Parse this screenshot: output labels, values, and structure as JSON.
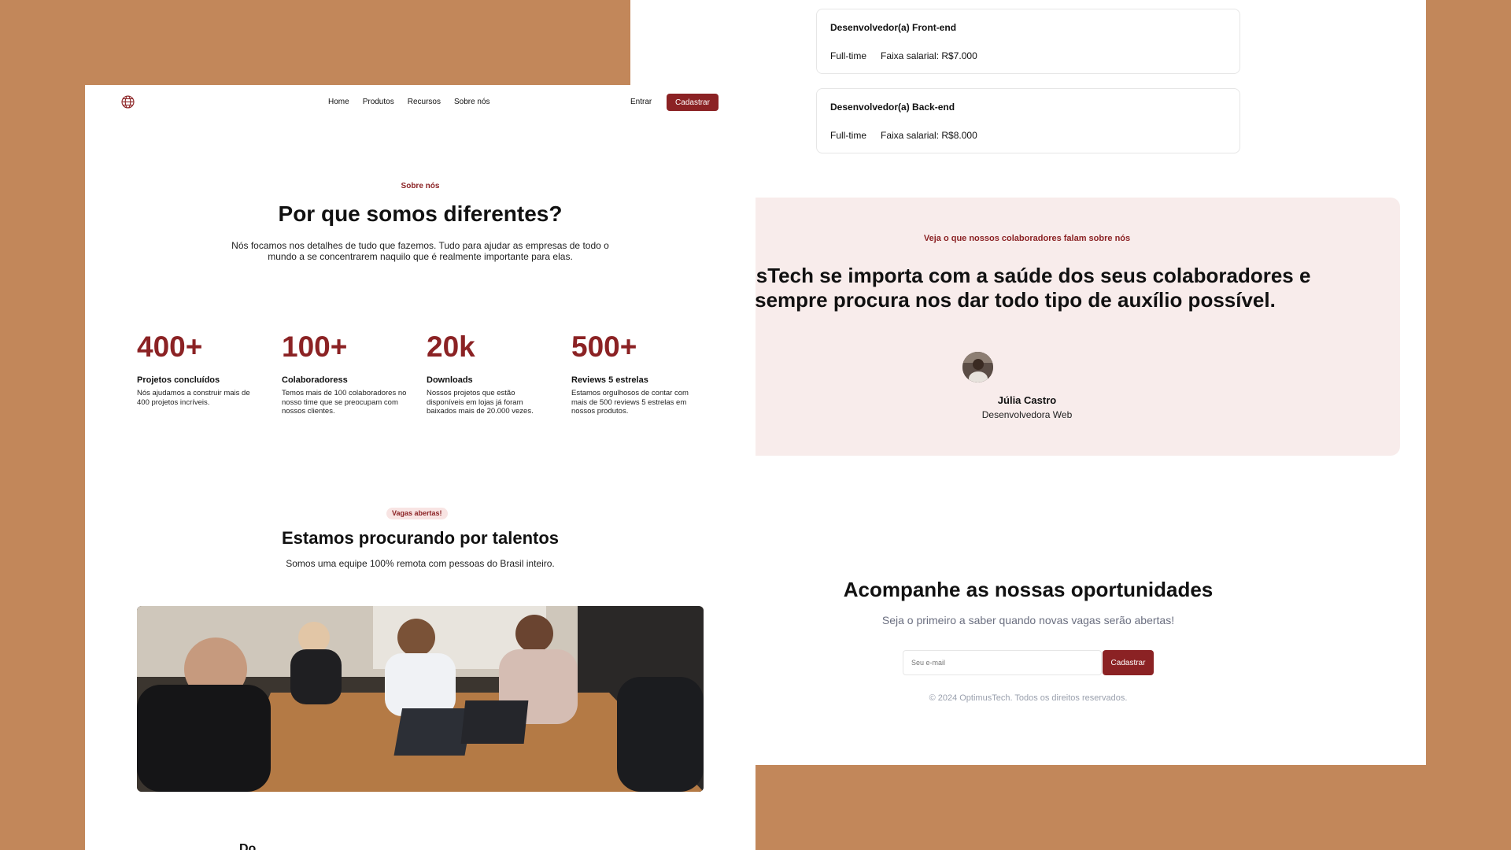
{
  "right": {
    "jobs": [
      {
        "title": "Desenvolvedor(a) Front-end",
        "type": "Full-time",
        "salary": "Faixa salarial: R$7.000"
      },
      {
        "title": "Desenvolvedor(a) Back-end",
        "type": "Full-time",
        "salary": "Faixa salarial: R$8.000"
      }
    ],
    "testimonial": {
      "kicker": "Veja o que nossos colaboradores falam sobre nós",
      "quote_line1": "imusTech se importa com a saúde dos seus colaboradores e",
      "quote_line2": "sempre procura nos dar todo tipo de auxílio possível.",
      "name": "Júlia Castro",
      "role": "Desenvolvedora Web"
    },
    "newsletter": {
      "title": "Acompanhe as nossas oportunidades",
      "subtitle": "Seja o primeiro a saber quando novas vagas serão abertas!",
      "email_placeholder": "Seu e-mail",
      "button": "Cadastrar"
    },
    "copyright": "© 2024 OptimusTech. Todos os direitos reservados."
  },
  "left": {
    "nav": [
      "Home",
      "Produtos",
      "Recursos",
      "Sobre nós"
    ],
    "login": "Entrar",
    "signup": "Cadastrar",
    "about": {
      "kicker": "Sobre nós",
      "title": "Por que somos diferentes?",
      "lead": "Nós focamos nos detalhes de tudo que fazemos. Tudo para ajudar as empresas de todo o mundo a se concentrarem naquilo que é realmente importante para elas."
    },
    "stats": [
      {
        "num": "400+",
        "label": "Projetos concluídos",
        "desc": "Nós ajudamos a construir mais de 400 projetos incríveis."
      },
      {
        "num": "100+",
        "label": "Colaboradoress",
        "desc": "Temos mais de 100 colaboradores no nosso time que se preocupam com nossos clientes."
      },
      {
        "num": "20k",
        "label": "Downloads",
        "desc": "Nossos projetos que estão disponíveis em lojas já foram baixados mais de 20.000 vezes."
      },
      {
        "num": "500+",
        "label": "Reviews 5 estrelas",
        "desc": "Estamos orgulhosos de contar com mais de 500 reviews 5 estrelas em nossos produtos."
      }
    ],
    "talent": {
      "badge": "Vagas abertas!",
      "title": "Estamos procurando por talentos",
      "subtitle": "Somos uma equipe 100% remota com pessoas do Brasil inteiro."
    },
    "cut_heading": "Do..."
  },
  "colors": {
    "accent": "#8b2224",
    "background": "#c2875a",
    "testimonial_bg": "#f8eceb"
  },
  "icons": {
    "logo": "globe-icon"
  }
}
